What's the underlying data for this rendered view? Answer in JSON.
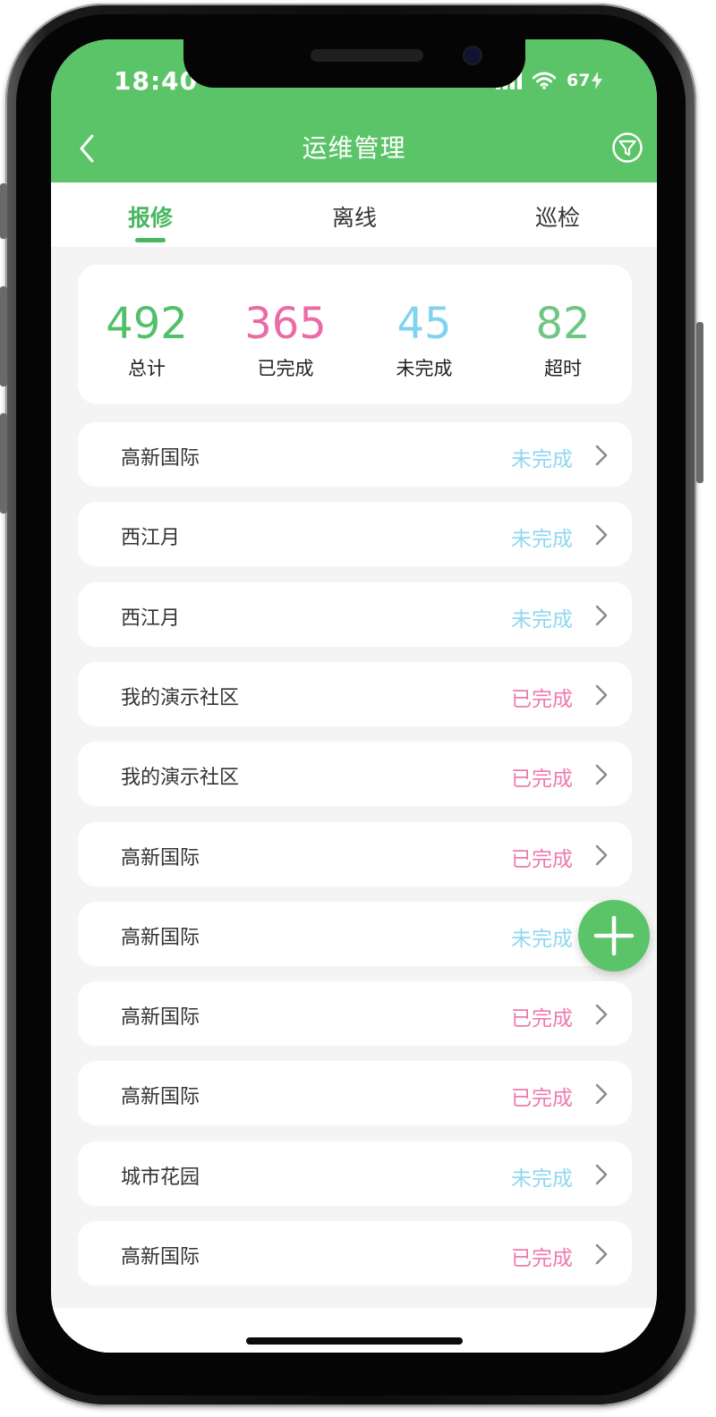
{
  "status_bar": {
    "time": "18:40",
    "battery": "67"
  },
  "nav": {
    "title": "运维管理"
  },
  "tabs": [
    {
      "label": "报修",
      "active": true
    },
    {
      "label": "离线",
      "active": false
    },
    {
      "label": "巡检",
      "active": false
    }
  ],
  "stats": [
    {
      "value": "492",
      "label": "总计",
      "color": "#52bf6a"
    },
    {
      "value": "365",
      "label": "已完成",
      "color": "#ec6aa6"
    },
    {
      "value": "45",
      "label": "未完成",
      "color": "#7fd3f0"
    },
    {
      "value": "82",
      "label": "超时",
      "color": "#6fc683"
    }
  ],
  "list": [
    {
      "name": "高新国际",
      "status": "未完成",
      "state": "pending"
    },
    {
      "name": "西江月",
      "status": "未完成",
      "state": "pending"
    },
    {
      "name": "西江月",
      "status": "未完成",
      "state": "pending"
    },
    {
      "name": "我的演示社区",
      "status": "已完成",
      "state": "done"
    },
    {
      "name": "我的演示社区",
      "status": "已完成",
      "state": "done"
    },
    {
      "name": "高新国际",
      "status": "已完成",
      "state": "done"
    },
    {
      "name": "高新国际",
      "status": "未完成",
      "state": "pending"
    },
    {
      "name": "高新国际",
      "status": "已完成",
      "state": "done"
    },
    {
      "name": "高新国际",
      "status": "已完成",
      "state": "done"
    },
    {
      "name": "城市花园",
      "status": "未完成",
      "state": "pending"
    },
    {
      "name": "高新国际",
      "status": "已完成",
      "state": "done"
    }
  ],
  "colors": {
    "header": "#5cc468",
    "accent": "#47b860",
    "pending": "#8fd8ef",
    "done": "#ee7ab0"
  },
  "icons": {
    "back": "chevron-left-icon",
    "filter": "filter-icon",
    "row": "chevron-right-icon",
    "fab": "plus-icon"
  }
}
